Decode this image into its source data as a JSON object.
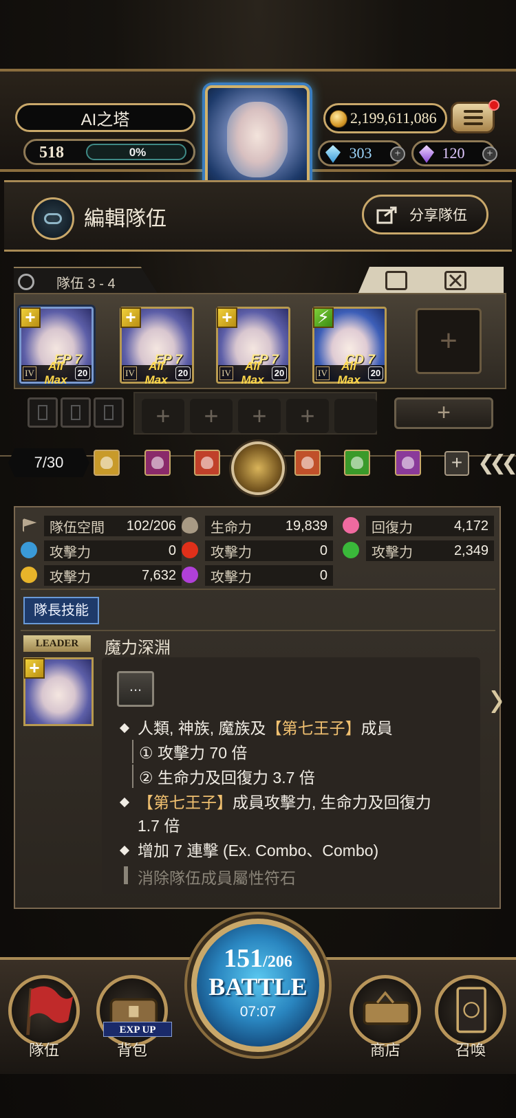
{
  "header": {
    "player_name": "AI之塔",
    "level": "518",
    "exp_percent": "0%",
    "gold": "2,199,611,086",
    "diamonds": "303",
    "souls": "120",
    "menu_has_notification": true
  },
  "edit_bar": {
    "title": "編輯隊伍",
    "share_label": "分享隊伍"
  },
  "team": {
    "tab_label": "隊伍 3 - 4",
    "cards": [
      {
        "attribute": "light",
        "attr_icon": "+",
        "skill": "EP 7",
        "rank": "IV",
        "status": "All Max",
        "level": "20"
      },
      {
        "attribute": "light",
        "attr_icon": "+",
        "skill": "EP 7",
        "rank": "IV",
        "status": "All Max",
        "level": "20"
      },
      {
        "attribute": "light",
        "attr_icon": "+",
        "skill": "EP 7",
        "rank": "IV",
        "status": "All Max",
        "level": "20"
      },
      {
        "attribute": "wood",
        "attr_icon": "⚡",
        "skill": "CD 7",
        "rank": "IV",
        "status": "All Max",
        "level": "20"
      }
    ],
    "empty_slot_symbol": "+"
  },
  "filters": {
    "count": "7/30",
    "icons": [
      "elf-light-icon",
      "demon-icon",
      "beast-butterfly-icon",
      "human-gold-icon",
      "human-red-icon",
      "beast-paw-icon",
      "human-purple-icon"
    ],
    "colors": [
      "#c89a2a",
      "#8a2a6a",
      "#c0402a",
      "#c9a040",
      "#c0502a",
      "#3a9a2a",
      "#8a3a9a"
    ]
  },
  "stats": {
    "team_space_label": "隊伍空間",
    "team_space": "102/206",
    "hp_label": "生命力",
    "hp": "19,839",
    "recovery_label": "回復力",
    "recovery": "4,172",
    "water_atk_label": "攻擊力",
    "water_atk": "0",
    "fire_atk_label": "攻擊力",
    "fire_atk": "0",
    "wood_atk_label": "攻擊力",
    "wood_atk": "2,349",
    "light_atk_label": "攻擊力",
    "light_atk": "7,632",
    "dark_atk_label": "攻擊力",
    "dark_atk": "0"
  },
  "leader": {
    "tab_label": "隊長技能",
    "badge": "LEADER",
    "skill_name": "魔力深淵",
    "dots": "...",
    "lines": {
      "l1a": "人類, 神族, 魔族及",
      "l1b": "【第七王子】",
      "l1c": "成員",
      "l2": "① 攻擊力 70 倍",
      "l3": "② 生命力及回復力 3.7 倍",
      "l4a": "【第七王子】",
      "l4b": "成員攻擊力, 生命力及回復力",
      "l5": "1.7 倍",
      "l6": "增加 7 連擊 (Ex. Combo、Combo)",
      "l7": "消除隊伍成員屬性符石"
    }
  },
  "bottom_nav": {
    "team": "隊伍",
    "bag": "背包",
    "bag_badge": "EXP UP",
    "stamina_current": "151",
    "stamina_max": "/206",
    "battle": "BATTLE",
    "timer": "07:07",
    "shop": "商店",
    "summon": "召喚"
  }
}
